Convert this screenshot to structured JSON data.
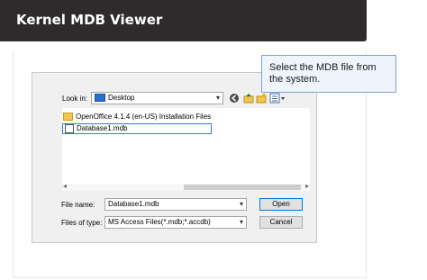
{
  "header": {
    "title": "Kernel MDB Viewer"
  },
  "tooltip": {
    "text": "Select the MDB file from the system."
  },
  "dialog": {
    "look_in_label": "Look in:",
    "look_in_value": "Desktop",
    "files": [
      {
        "name": "OpenOffice 4.1.4 (en-US) Installation Files",
        "type": "folder"
      },
      {
        "name": "Database1.mdb",
        "type": "mdb",
        "selected": true
      }
    ],
    "file_name_label": "File name:",
    "file_name_value": "Database1.mdb",
    "file_type_label": "Files of type:",
    "file_type_value": "MS Access Files(*.mdb;*.accdb)",
    "open_label": "Open",
    "cancel_label": "Cancel"
  },
  "icons": [
    "desktop-drive-icon",
    "back-icon",
    "up-folder-icon",
    "new-folder-icon",
    "view-menu-icon",
    "folder-icon",
    "database-file-icon"
  ],
  "colors": {
    "header_bg": "#2e2b2c",
    "tooltip_bg": "#eef5fd",
    "tooltip_border": "#7aa3d4",
    "selection_border": "#3a7bd5"
  }
}
